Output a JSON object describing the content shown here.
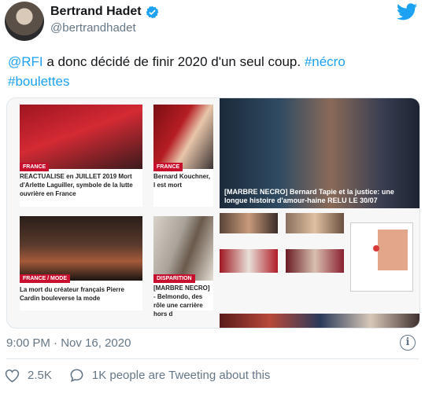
{
  "author": {
    "name": "Bertrand Hadet",
    "handle": "@bertrandhadet"
  },
  "tweet": {
    "mention": "@RFI",
    "body": " a donc décidé de finir 2020 d'un seul coup. ",
    "hashtag1": "#nécro",
    "hashtag2": "#boulettes"
  },
  "embed": {
    "cards": [
      {
        "tag": "FRANCE",
        "caption": "REACTUALISE en JUILLET 2019 Mort d'Arlette Laguiller, symbole de la lutte ouvrière en France"
      },
      {
        "tag": "FRANCE",
        "caption": "Bernard Kouchner, l est mort"
      },
      {
        "tag": "",
        "caption": "[MARBRE NECRO] Bernard Tapie et la justice: une longue histoire d'amour-haine RELU LE 30/07"
      },
      {
        "tag": "FRANCE / MODE",
        "caption": "La mort du créateur français Pierre Cardin bouleverse la mode"
      },
      {
        "tag": "DISPARITION",
        "caption": "[MARBRE NECRO] - Belmondo, des rôle une carrière hors d"
      }
    ]
  },
  "meta": {
    "time": "9:00 PM",
    "separator": "·",
    "date": "Nov 16, 2020"
  },
  "actions": {
    "likes": "2.5K",
    "tweeting": "1K people are Tweeting about this"
  },
  "colors": {
    "link": "#1da1f2",
    "secondary_text": "#657786",
    "rfi_red": "#c8102e"
  }
}
